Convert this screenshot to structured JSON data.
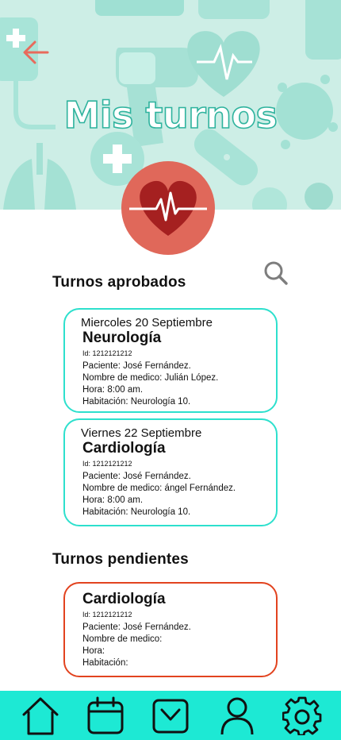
{
  "header": {
    "title": "Mis turnos"
  },
  "approved": {
    "heading": "Turnos  aprobados",
    "cards": [
      {
        "date": "Miercoles 20 Septiembre",
        "specialty": "Neurología",
        "id": "Id: 1212121212",
        "patient": "Paciente: José Fernández.",
        "doctor": "Nombre de medico: Julián López.",
        "time": "Hora: 8:00 am.",
        "room": "Habitación: Neurología 10."
      },
      {
        "date": "Viernes 22 Septiembre",
        "specialty": "Cardiología",
        "id": "Id: 1212121212",
        "patient": "Paciente: José Fernández.",
        "doctor": "Nombre de medico: ángel Fernández.",
        "time": "Hora: 8:00 am.",
        "room": "Habitación: Neurología 10."
      }
    ]
  },
  "pending": {
    "heading": "Turnos  pendientes",
    "cards": [
      {
        "specialty": "Cardiología",
        "id": "Id: 1212121212",
        "patient": "Paciente: José Fernández.",
        "doctor": "Nombre de medico:",
        "time": "Hora:",
        "room": "Habitación:"
      }
    ]
  },
  "icons": {
    "back": "arrow-left-icon",
    "logo": "heart-pulse-icon",
    "search": "search-icon",
    "nav": [
      "home-icon",
      "calendar-icon",
      "inbox-icon",
      "user-icon",
      "gear-icon"
    ]
  },
  "colors": {
    "header_bg": "#cdeee6",
    "accent_teal": "#1de9d4",
    "approved_border": "#2de0cd",
    "pending_border": "#e2431f",
    "logo_circle": "#e0685a",
    "back_arrow": "#e86a5c"
  }
}
